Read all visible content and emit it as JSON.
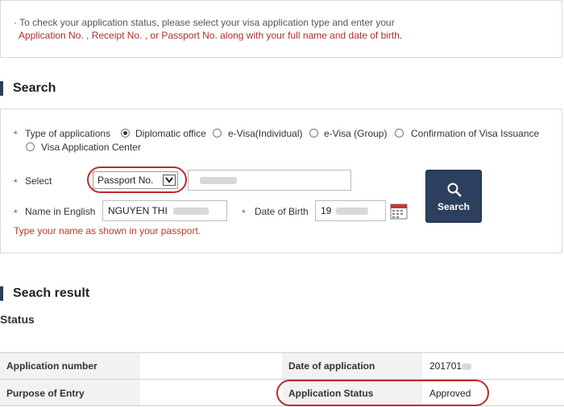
{
  "notice": {
    "line1": "· To check your application status, please select your visa application type and enter your",
    "line2": "Application No. , Receipt No. , or Passport No. along with your full name and date of birth."
  },
  "search": {
    "heading": "Search",
    "type_label": "Type of applications",
    "options": [
      "Diplomatic office",
      "e-Visa(Individual)",
      "e-Visa (Group)",
      "Confirmation of Visa Issuance",
      "Visa Application Center"
    ],
    "selected_option": "Diplomatic office",
    "select_label": "Select",
    "select_value": "Passport No.",
    "name_label": "Name in English",
    "name_value": "NGUYEN THI",
    "dob_label": "Date of Birth",
    "dob_value": "19",
    "hint": "Type your name as shown in your passport.",
    "button_label": "Search",
    "required_mark": "*"
  },
  "result": {
    "heading": "Seach result",
    "status_heading": "Status",
    "rows": [
      {
        "label": "Application number",
        "value": "",
        "label2": "Date of application",
        "value2": "201701"
      },
      {
        "label": "Purpose of Entry",
        "value": "",
        "label2": "Application Status",
        "value2": "Approved"
      }
    ]
  },
  "colors": {
    "accent": "#2c3f5e",
    "highlight": "#c0282b",
    "notice_red": "#a8322d"
  },
  "icons": {
    "search_button": "magnifier-icon",
    "date_picker": "calendar-icon"
  }
}
